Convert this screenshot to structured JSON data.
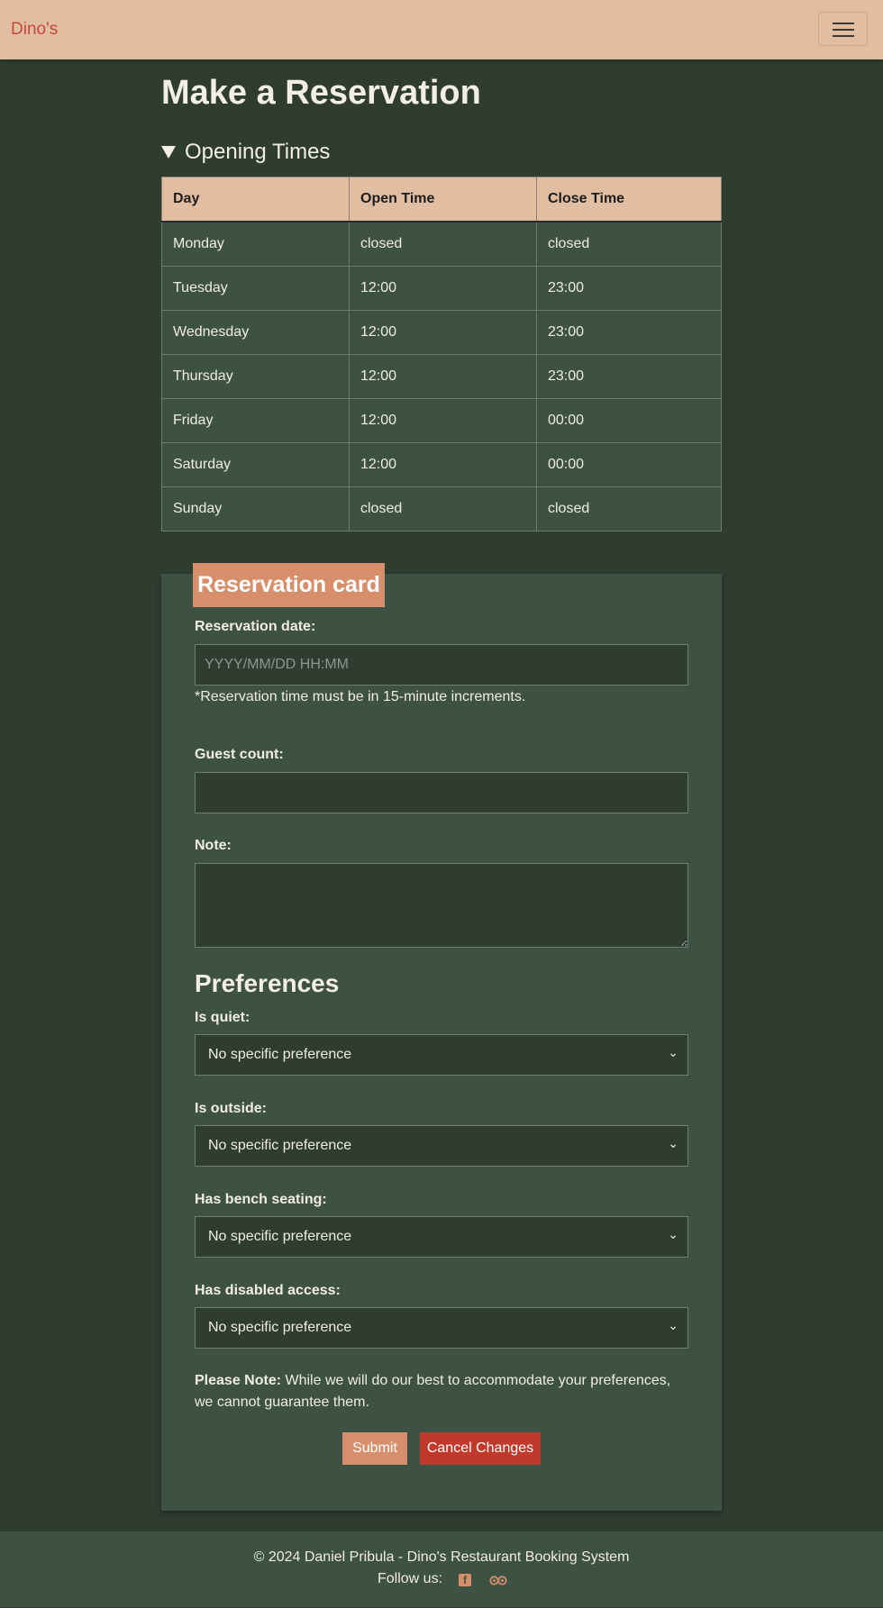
{
  "navbar": {
    "brand": "Dino's",
    "toggle_icon": "hamburger-menu-icon"
  },
  "page": {
    "title": "Make a Reservation"
  },
  "opening_times": {
    "summary": "Opening Times",
    "headers": [
      "Day",
      "Open Time",
      "Close Time"
    ],
    "rows": [
      [
        "Monday",
        "closed",
        "closed"
      ],
      [
        "Tuesday",
        "12:00",
        "23:00"
      ],
      [
        "Wednesday",
        "12:00",
        "23:00"
      ],
      [
        "Thursday",
        "12:00",
        "23:00"
      ],
      [
        "Friday",
        "12:00",
        "00:00"
      ],
      [
        "Saturday",
        "12:00",
        "00:00"
      ],
      [
        "Sunday",
        "closed",
        "closed"
      ]
    ]
  },
  "form": {
    "header": "Reservation card",
    "date_label": "Reservation date:",
    "date_placeholder": "YYYY/MM/DD HH:MM",
    "date_value": "",
    "date_hint": "*Reservation time must be in 15-minute increments.",
    "guest_label": "Guest count:",
    "guest_value": "",
    "note_label": "Note:",
    "note_value": "",
    "preferences_title": "Preferences",
    "preferences": [
      {
        "label": "Is quiet:",
        "value": "No specific preference"
      },
      {
        "label": "Is outside:",
        "value": "No specific preference"
      },
      {
        "label": "Has bench seating:",
        "value": "No specific preference"
      },
      {
        "label": "Has disabled access:",
        "value": "No specific preference"
      }
    ],
    "note_bold": "Please Note:",
    "note_text": " While we will do our best to accommodate your preferences, we cannot guarantee them.",
    "submit_label": "Submit",
    "cancel_label": "Cancel Changes"
  },
  "footer": {
    "copyright": "© 2024 Daniel Pribula - Dino's Restaurant Booking System",
    "follow": "Follow us:",
    "icons": [
      "facebook-icon",
      "tripadvisor-icon"
    ]
  },
  "colors": {
    "background": "#2f3c30",
    "card": "#3e5243",
    "navbar": "#e1bda2",
    "accent": "#d78f6b",
    "danger": "#c0392b",
    "brand": "#c8483a"
  }
}
